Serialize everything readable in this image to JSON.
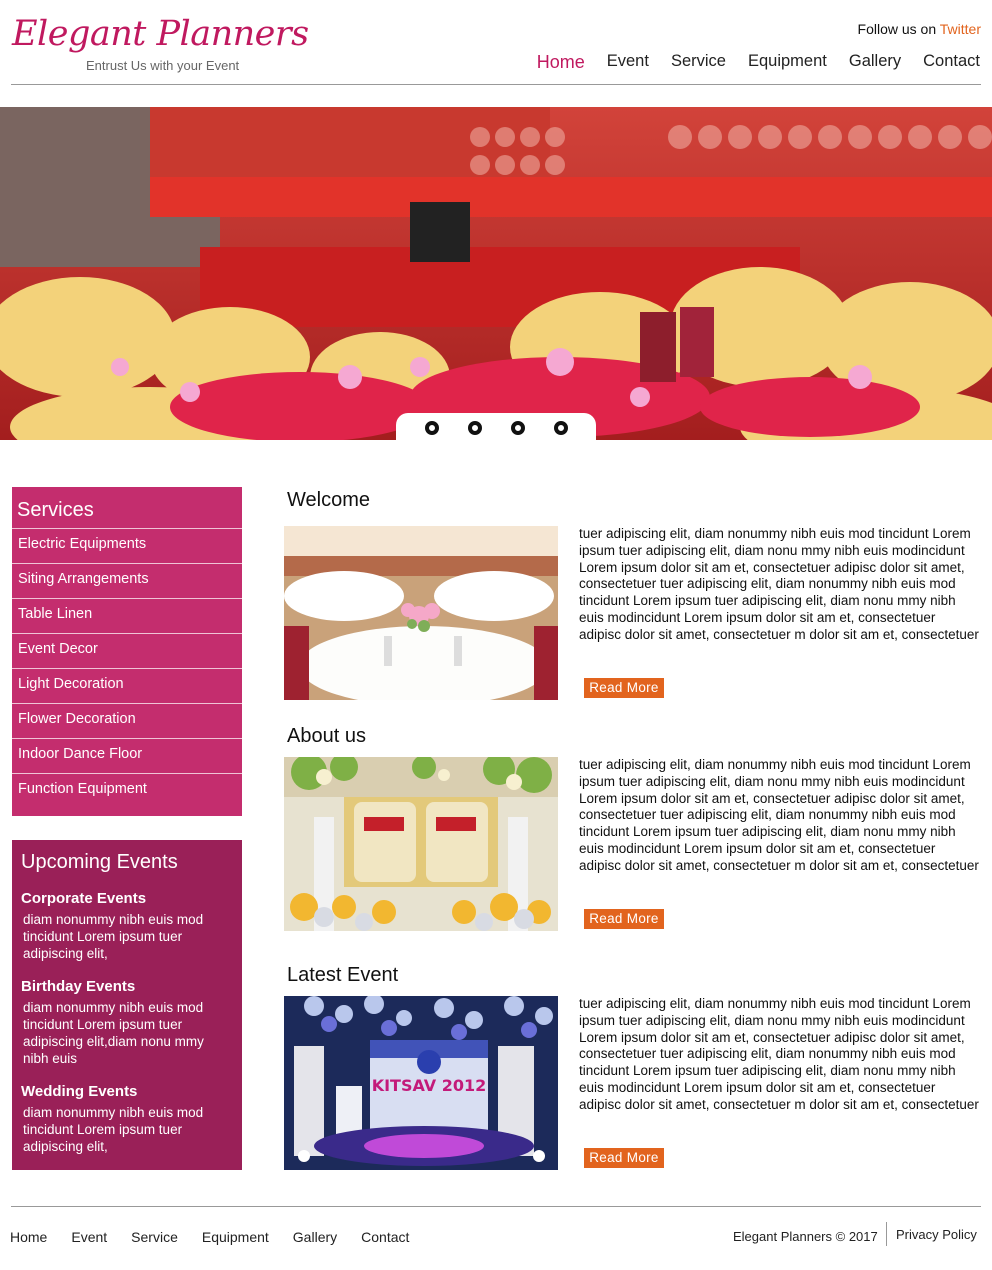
{
  "header": {
    "logo_title": "Elegant Planners",
    "logo_tagline": "Entrust Us with your Event",
    "follow_text": "Follow us on",
    "follow_link": "Twitter",
    "nav": [
      "Home",
      "Event",
      "Service",
      "Equipment",
      "Gallery",
      "Contact"
    ]
  },
  "sidebar": {
    "services_title": "Services",
    "services": [
      "Electric Equipments",
      "Siting Arrangements",
      "Table Linen",
      "Event Decor",
      "Light Decoration",
      "Flower Decoration",
      "Indoor Dance Floor",
      "Function Equipment"
    ],
    "upcoming_title": "Upcoming Events",
    "events": [
      {
        "title": "Corporate Events",
        "text": "diam nonummy nibh euis mod tincidunt Lorem ipsum tuer adipiscing elit,"
      },
      {
        "title": "Birthday Events",
        "text": "diam nonummy nibh euis mod tincidunt Lorem ipsum tuer adipiscing elit,diam nonu mmy nibh euis"
      },
      {
        "title": "Wedding Events",
        "text": "diam nonummy nibh euis mod tincidunt Lorem ipsum tuer adipiscing elit,"
      }
    ]
  },
  "sections": [
    {
      "title": "Welcome",
      "text": "tuer adipiscing elit, diam nonummy nibh euis mod tincidunt Lorem ipsum tuer adipiscing elit, diam nonu mmy nibh euis modincidunt Lorem ipsum dolor sit am et, consectetuer adipisc dolor sit amet, consectetuer tuer adipiscing elit, diam nonummy nibh euis mod tincidunt Lorem ipsum tuer adipiscing elit, diam nonu mmy nibh euis modincidunt Lorem ipsum dolor sit am et, consectetuer adipisc dolor sit amet, consectetuer m dolor sit am et, consectetuer",
      "button": "Read More"
    },
    {
      "title": "About us",
      "text": "tuer adipiscing elit, diam nonummy nibh euis mod tincidunt Lorem ipsum tuer adipiscing elit, diam nonu mmy nibh euis modincidunt Lorem ipsum dolor sit am et, consectetuer adipisc dolor sit amet, consectetuer tuer adipiscing elit, diam nonummy nibh euis mod tincidunt Lorem ipsum tuer adipiscing elit, diam nonu mmy nibh euis modincidunt Lorem ipsum dolor sit am et, consectetuer adipisc dolor sit amet, consectetuer m dolor sit am et, consectetuer",
      "button": "Read More"
    },
    {
      "title": "Latest Event",
      "text": "tuer adipiscing elit, diam nonummy nibh euis mod tincidunt Lorem ipsum tuer adipiscing elit, diam nonu mmy nibh euis modincidunt Lorem ipsum dolor sit am et, consectetuer adipisc dolor sit amet, consectetuer tuer adipiscing elit, diam nonummy nibh euis mod tincidunt Lorem ipsum tuer adipiscing elit, diam nonu mmy nibh euis modincidunt Lorem ipsum dolor sit am et, consectetuer adipisc dolor sit amet, consectetuer m dolor sit am et, consectetuer",
      "button": "Read More"
    }
  ],
  "event_image_text": "KITSAV 2012",
  "footer": {
    "nav": [
      "Home",
      "Event",
      "Service",
      "Equipment",
      "Gallery",
      "Contact"
    ],
    "copyright": "Elegant Planners © 2017",
    "privacy": "Privacy Policy"
  },
  "colors": {
    "brand": "#c0195f",
    "sidebar": "#c42d6e",
    "upcoming": "#9a2058",
    "accent": "#e2641e"
  }
}
